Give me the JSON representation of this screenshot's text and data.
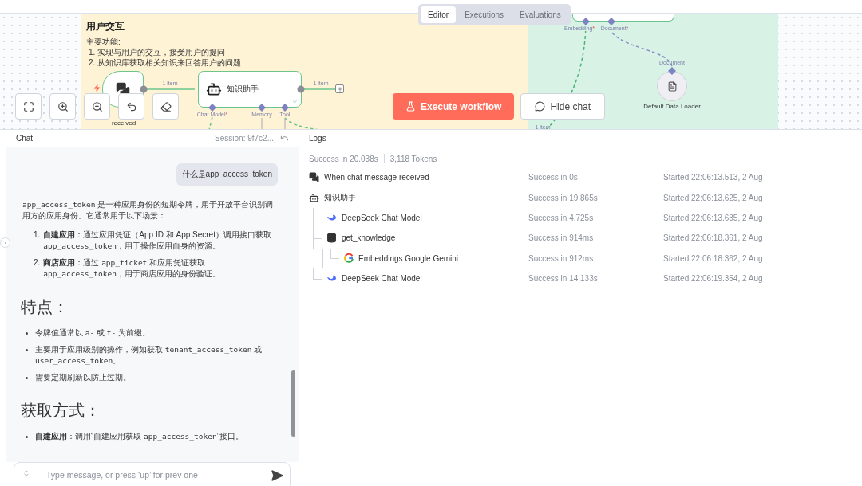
{
  "canvas": {
    "tabs": [
      {
        "label": "Editor",
        "selected": true
      },
      {
        "label": "Executions",
        "selected": false
      },
      {
        "label": "Evaluations",
        "selected": false
      }
    ],
    "sticky": {
      "title": "用户交互",
      "subtitle": "主要功能:",
      "items": [
        "1. 实现与用户的交互，接受用户的提问",
        "2. 从知识库获取相关知识来回答用户的问题"
      ]
    },
    "trigger": {
      "label": "received"
    },
    "agent": {
      "label": "知识助手",
      "done": true,
      "inputs": [
        {
          "label": "Chat Model",
          "mark": "*"
        },
        {
          "label": "Memory"
        },
        {
          "label": "Tool"
        }
      ]
    },
    "edge_labels": [
      "1 item",
      "1 item",
      "1 item"
    ],
    "store": {
      "inputs": [
        {
          "label": "Embedding",
          "mark": "*"
        },
        {
          "label": "Document",
          "mark": "*"
        }
      ]
    },
    "loader": {
      "input": "Document",
      "label": "Default Data Loader"
    },
    "execute_button": "Execute workflow",
    "chat_button": "Hide chat"
  },
  "chat": {
    "title": "Chat",
    "session": "Session: 9f7c2...",
    "question": "什么是app_access_token",
    "answer": [
      {
        "kind": "paragraph",
        "parts": [
          {
            "kind": "code",
            "text": "app_access_token"
          },
          {
            "kind": "plain",
            "text": " 是一种应用身份的短期令牌，用于开放平台识别调用方的应用身份。它通常用于以下场景："
          }
        ]
      },
      {
        "kind": "ordered",
        "items": [
          {
            "number": "1.",
            "parts": [
              {
                "kind": "bold",
                "text": "自建应用"
              },
              {
                "kind": "plain",
                "text": "：通过应用凭证（App ID 和 App Secret）调用接口获取 "
              },
              {
                "kind": "code",
                "text": "app_access_token"
              },
              {
                "kind": "plain",
                "text": "，用于操作应用自身的资源。"
              }
            ]
          },
          {
            "number": "2.",
            "parts": [
              {
                "kind": "bold",
                "text": "商店应用"
              },
              {
                "kind": "plain",
                "text": "：通过 "
              },
              {
                "kind": "code",
                "text": "app_ticket"
              },
              {
                "kind": "plain",
                "text": " 和应用凭证获取 "
              },
              {
                "kind": "code",
                "text": "app_access_token"
              },
              {
                "kind": "plain",
                "text": "，用于商店应用的身份验证。"
              }
            ]
          }
        ]
      },
      {
        "kind": "heading",
        "text": "特点："
      },
      {
        "kind": "bullets",
        "items": [
          {
            "parts": [
              {
                "kind": "plain",
                "text": "令牌值通常以 "
              },
              {
                "kind": "code",
                "text": "a-"
              },
              {
                "kind": "plain",
                "text": " 或 "
              },
              {
                "kind": "code",
                "text": "t-"
              },
              {
                "kind": "plain",
                "text": " 为前缀。"
              }
            ]
          },
          {
            "parts": [
              {
                "kind": "plain",
                "text": "主要用于应用级别的操作，例如获取 "
              },
              {
                "kind": "code",
                "text": "tenant_access_token"
              },
              {
                "kind": "plain",
                "text": " 或 "
              },
              {
                "kind": "code",
                "text": "user_access_token"
              },
              {
                "kind": "plain",
                "text": "。"
              }
            ]
          },
          {
            "parts": [
              {
                "kind": "plain",
                "text": "需要定期刷新以防止过期。"
              }
            ]
          }
        ]
      },
      {
        "kind": "heading",
        "text": "获取方式："
      },
      {
        "kind": "bullets",
        "items": [
          {
            "parts": [
              {
                "kind": "bold",
                "text": "自建应用"
              },
              {
                "kind": "plain",
                "text": "：调用“自建应用获取 "
              },
              {
                "kind": "code",
                "text": "app_access_token"
              },
              {
                "kind": "plain",
                "text": "”接口。"
              }
            ]
          }
        ]
      }
    ],
    "placeholder": "Type message, or press ‘up’ for prev one"
  },
  "logs": {
    "title": "Logs",
    "summary": "Success in 20.038s",
    "tokens": "3,118 Tokens",
    "rows": [
      {
        "kind": "chat",
        "name": "When chat message received",
        "status": "Success in 0s",
        "started": "Started 22:06:13.513, 2 Aug"
      },
      {
        "kind": "agent",
        "name": "知识助手",
        "status": "Success in 19.865s",
        "started": "Started 22:06:13.625, 2 Aug",
        "children": [
          {
            "kind": "model",
            "name": "DeepSeek Chat Model",
            "status": "Success in 4.725s",
            "started": "Started 22:06:13.635, 2 Aug"
          },
          {
            "kind": "tool",
            "name": "get_knowledge",
            "status": "Success in 914ms",
            "started": "Started 22:06:18.361, 2 Aug",
            "children": [
              {
                "kind": "embedding",
                "name": "Embeddings Google Gemini",
                "status": "Success in 912ms",
                "started": "Started 22:06:18.362, 2 Aug"
              }
            ]
          },
          {
            "kind": "model",
            "name": "DeepSeek Chat Model",
            "status": "Success in 14.133s",
            "started": "Started 22:06:19.354, 2 Aug"
          }
        ]
      }
    ]
  }
}
